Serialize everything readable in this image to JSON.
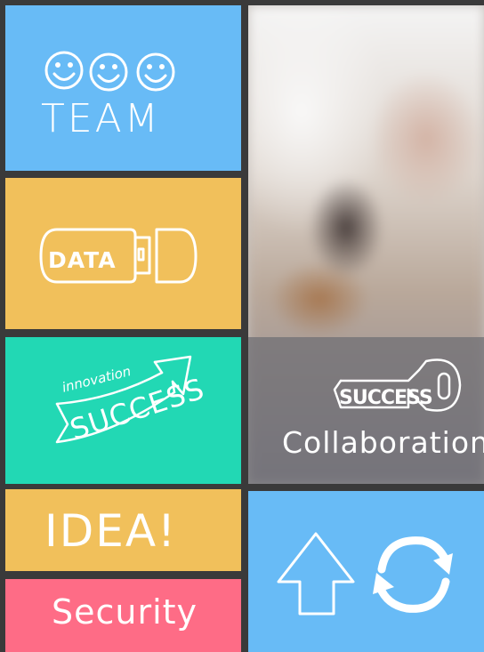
{
  "tiles": {
    "team": {
      "label": "TEAM"
    },
    "data": {
      "label": "DATA"
    },
    "innovation": {
      "script_word": "innovation",
      "main_word": "SUCCESS"
    },
    "idea": {
      "label": "IDEA!"
    },
    "security": {
      "label": "Security"
    },
    "photo": {
      "key_word": "SUCCESS",
      "caption": "Collaboration"
    }
  },
  "icons": {
    "team": "smiley-faces-icon",
    "data": "usb-drive-icon",
    "innovation": "arrow-banner-icon",
    "photo_key": "key-icon",
    "upload": "up-arrow-icon",
    "refresh": "refresh-icon"
  },
  "colors": {
    "background": "#3a3a3a",
    "blue": "#68bbf6",
    "yellow": "#f1c05b",
    "teal": "#22d8b4",
    "pink": "#fe6c86",
    "overlay": "#6e6e73"
  }
}
